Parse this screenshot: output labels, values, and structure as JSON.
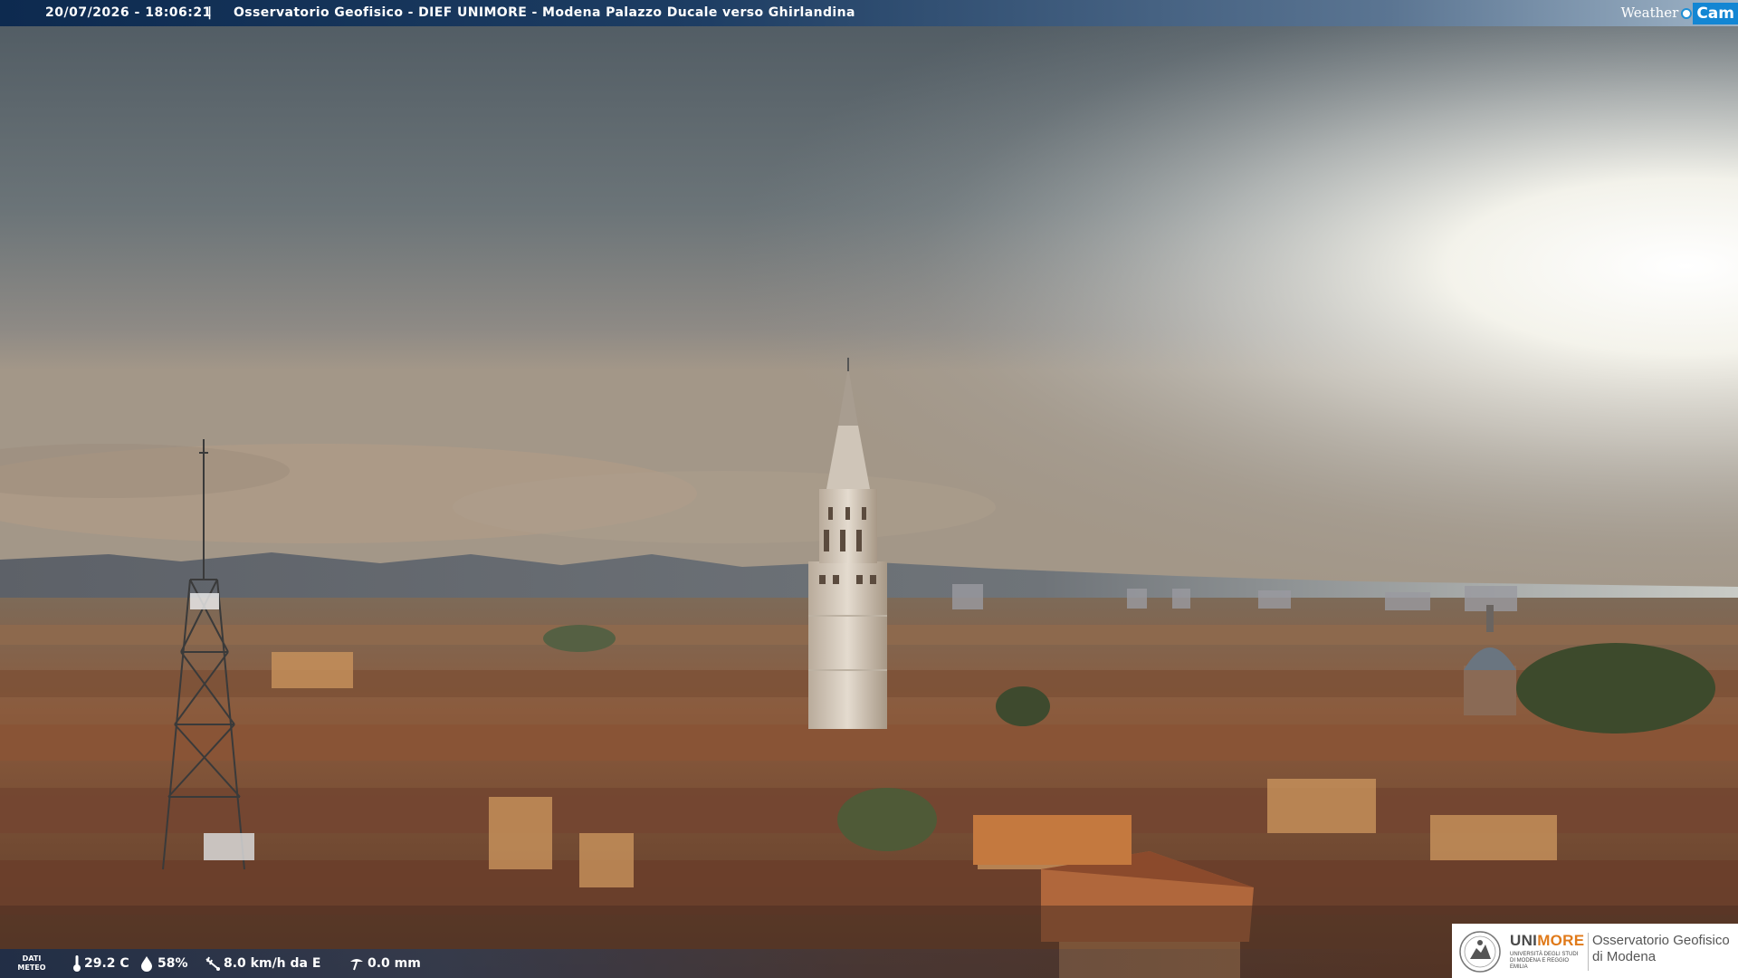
{
  "header": {
    "datetime": "20/07/2026 - 18:06:21",
    "separator": "|",
    "title": "Osservatorio Geofisico - DIEF UNIMORE - Modena Palazzo Ducale verso Ghirlandina",
    "brand_left": "Weather",
    "brand_right": "Cam",
    "brand_color": "#1386d3"
  },
  "weather": {
    "label_line1": "DATI",
    "label_line2": "METEO",
    "temperature": "29.2 C",
    "humidity": "58%",
    "wind": "8.0 km/h da E",
    "rain": "0.0 mm",
    "icons": [
      "thermometer-icon",
      "droplet-icon",
      "wind-icon",
      "rain-gauge-icon"
    ]
  },
  "logo": {
    "uni_part1": "UNI",
    "uni_part2": "MORE",
    "uni_sub": "UNIVERSITÀ DEGLI STUDI DI MODENA E REGGIO EMILIA",
    "obs_line1": "Osservatorio Geofisico",
    "obs_line2": "di Modena",
    "accent": "#e07a1a"
  },
  "scene": {
    "subject": "Panorama of Modena rooftops with the Ghirlandina tower and a radio mast under a cloudy sky",
    "colors": {
      "sky_dark": "#5f686d",
      "sky_bright": "#f2f0e6",
      "roofs": "#8a5a3c",
      "tower": "#d9d0c4"
    }
  }
}
